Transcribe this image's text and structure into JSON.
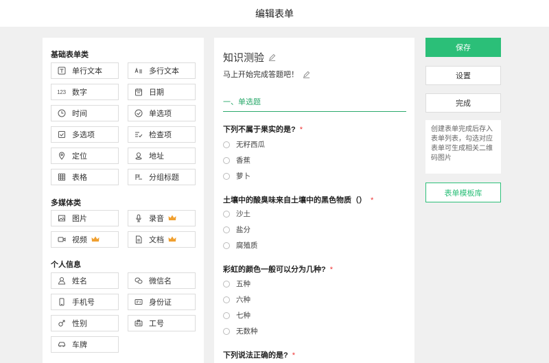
{
  "header": {
    "title": "编辑表单"
  },
  "palette": {
    "basic": {
      "title": "基础表单类",
      "items": [
        {
          "label": "单行文本",
          "icon": "single-line-text-icon"
        },
        {
          "label": "多行文本",
          "icon": "multi-line-text-icon"
        },
        {
          "label": "数字",
          "icon": "number-icon",
          "icon_text": "123"
        },
        {
          "label": "日期",
          "icon": "calendar-icon"
        },
        {
          "label": "时间",
          "icon": "clock-icon"
        },
        {
          "label": "单选项",
          "icon": "check-circle-icon"
        },
        {
          "label": "多选项",
          "icon": "checkbox-icon"
        },
        {
          "label": "检查项",
          "icon": "checklist-icon"
        },
        {
          "label": "定位",
          "icon": "location-pin-icon"
        },
        {
          "label": "地址",
          "icon": "map-pin-icon"
        },
        {
          "label": "表格",
          "icon": "table-icon"
        },
        {
          "label": "分组标题",
          "icon": "group-title-icon"
        }
      ]
    },
    "media": {
      "title": "多媒体类",
      "items": [
        {
          "label": "图片",
          "icon": "image-icon",
          "premium": false
        },
        {
          "label": "录音",
          "icon": "microphone-icon",
          "premium": true
        },
        {
          "label": "视频",
          "icon": "video-icon",
          "premium": true
        },
        {
          "label": "文档",
          "icon": "document-icon",
          "premium": true
        }
      ]
    },
    "personal": {
      "title": "个人信息",
      "items": [
        {
          "label": "姓名",
          "icon": "user-icon"
        },
        {
          "label": "微信名",
          "icon": "wechat-icon"
        },
        {
          "label": "手机号",
          "icon": "phone-icon"
        },
        {
          "label": "身份证",
          "icon": "id-card-icon"
        },
        {
          "label": "性别",
          "icon": "gender-icon"
        },
        {
          "label": "工号",
          "icon": "badge-icon"
        },
        {
          "label": "车牌",
          "icon": "car-icon"
        }
      ]
    }
  },
  "form": {
    "title": "知识测验",
    "description": "马上开始完成答题吧！",
    "section": "一、单选题",
    "questions": [
      {
        "title": "下列不属于果实的是?",
        "required": "*",
        "options": [
          "无籽西瓜",
          "香蕉",
          "萝卜"
        ]
      },
      {
        "title": "土壤中的酸臭味来自土壤中的黑色物质（）",
        "required": "*",
        "options": [
          "沙土",
          "盐分",
          "腐殖质"
        ]
      },
      {
        "title": "彩虹的颜色一般可以分为几种?",
        "required": "*",
        "options": [
          "五种",
          "六种",
          "七种",
          "无数种"
        ]
      },
      {
        "title": "下列说法正确的是?",
        "required": "*",
        "options": []
      }
    ]
  },
  "actions": {
    "save": "保存",
    "settings": "设置",
    "done": "完成",
    "tip": "创建表单完成后存入表单列表，勾选对应表单可生成相关二维码图片",
    "template_library": "表单模板库"
  },
  "colors": {
    "accent": "#2bbf78",
    "required": "#ee3333",
    "crown": "#f0a030"
  }
}
